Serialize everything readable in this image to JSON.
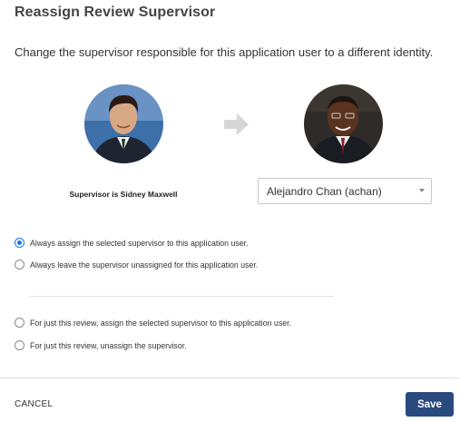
{
  "dialog": {
    "title": "Reassign Review Supervisor",
    "description": "Change the supervisor responsible for this application user to a different identity."
  },
  "current_supervisor": {
    "label": "Supervisor is Sidney Maxwell"
  },
  "new_supervisor": {
    "selected": "Alejandro Chan (achan)"
  },
  "options": [
    {
      "label": "Always assign the selected supervisor to this application user.",
      "checked": true
    },
    {
      "label": "Always leave the supervisor unassigned for this application user.",
      "checked": false
    },
    {
      "label": "For just this review, assign the selected supervisor to this application user.",
      "checked": false
    },
    {
      "label": "For just this review, unassign the supervisor.",
      "checked": false
    }
  ],
  "footer": {
    "cancel_label": "CANCEL",
    "save_label": "Save"
  },
  "colors": {
    "primary_button": "#284a7e",
    "radio_accent": "#1a73e8"
  },
  "icons": {
    "arrow": "arrow-right-icon",
    "caret": "chevron-down-icon"
  }
}
